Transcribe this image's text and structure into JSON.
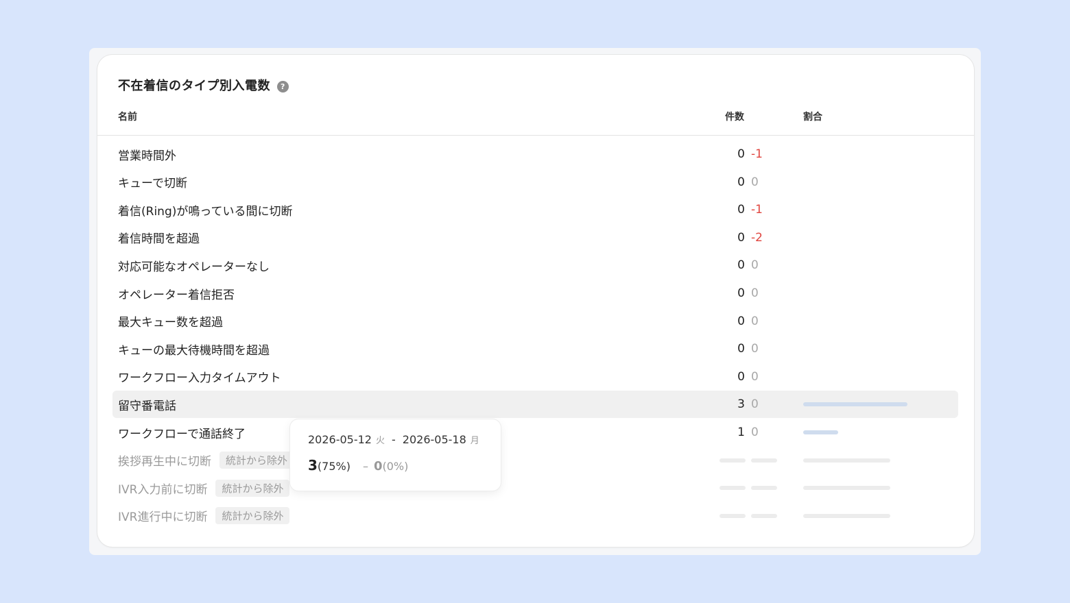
{
  "widget": {
    "title": "不在着信のタイプ別入電数",
    "help_icon": "question-circle-icon"
  },
  "table": {
    "columns": {
      "name": "名前",
      "count": "件数",
      "ratio": "割合"
    },
    "rows": [
      {
        "name": "営業時間外",
        "count": "0",
        "diff": "-1",
        "diff_negative": true
      },
      {
        "name": "キューで切断",
        "count": "0",
        "diff": "0"
      },
      {
        "name": "着信(Ring)が鳴っている間に切断",
        "count": "0",
        "diff": "-1",
        "diff_negative": true
      },
      {
        "name": "着信時間を超過",
        "count": "0",
        "diff": "-2",
        "diff_negative": true
      },
      {
        "name": "対応可能なオペレーターなし",
        "count": "0",
        "diff": "0"
      },
      {
        "name": "オペレーター着信拒否",
        "count": "0",
        "diff": "0"
      },
      {
        "name": "最大キュー数を超過",
        "count": "0",
        "diff": "0"
      },
      {
        "name": "キューの最大待機時間を超過",
        "count": "0",
        "diff": "0"
      },
      {
        "name": "ワークフロー入力タイムアウト",
        "count": "0",
        "diff": "0"
      },
      {
        "name": "留守番電話",
        "count": "3",
        "diff": "0",
        "ratio": 0.75,
        "highlighted": true
      },
      {
        "name": "ワークフローで通話終了",
        "count": "1",
        "diff": "0",
        "ratio": 0.25
      }
    ],
    "excluded_rows": [
      {
        "name": "挨拶再生中に切断",
        "badge": "統計から除外"
      },
      {
        "name": "IVR入力前に切断",
        "badge": "統計から除外"
      },
      {
        "name": "IVR進行中に切断",
        "badge": "統計から除外"
      }
    ]
  },
  "tooltip": {
    "start_date": "2026-05-12",
    "start_dow": "火",
    "separator": "-",
    "end_date": "2026-05-18",
    "end_dow": "月",
    "value": "3",
    "value_pct": "(75%)",
    "dash": "–",
    "prev_value": "0",
    "prev_pct": "(0%)"
  },
  "colors": {
    "negative": "#e0453f",
    "bar": "#cfdcee",
    "background": "#d8e5fc"
  }
}
